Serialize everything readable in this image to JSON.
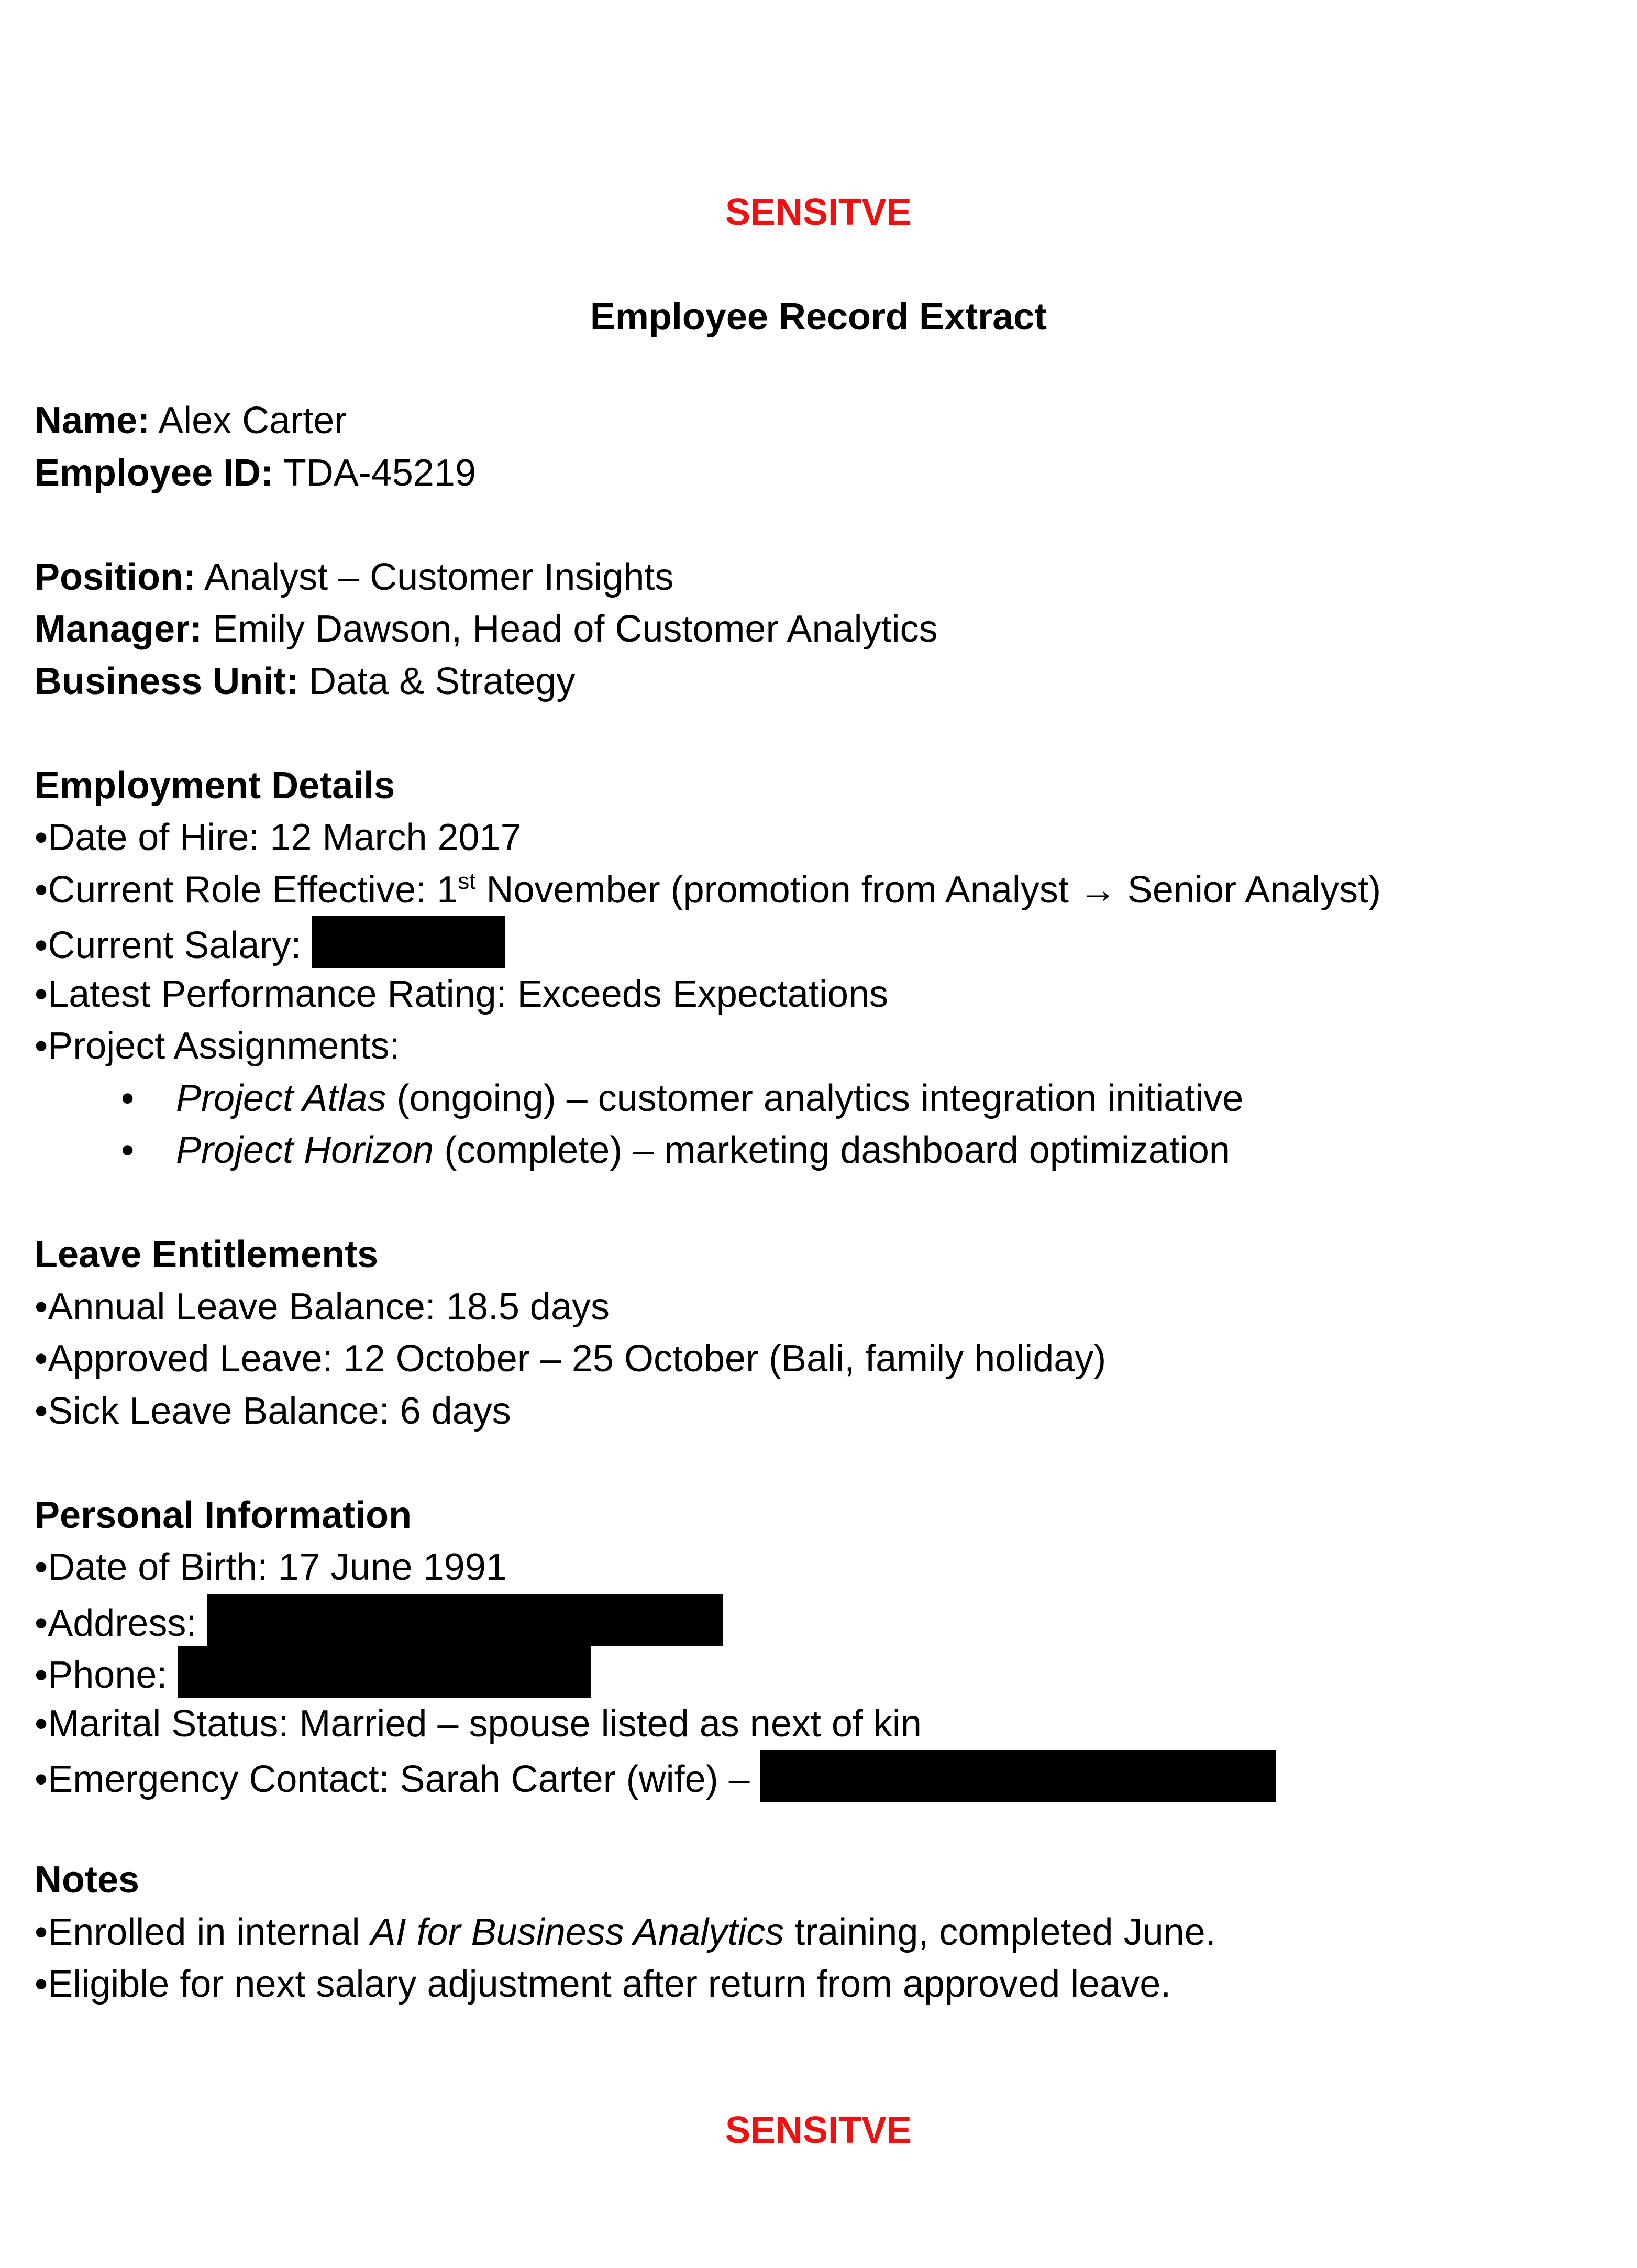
{
  "marking": {
    "top": "SENSITVE",
    "bottom": "SENSITVE",
    "color": "#ee1111"
  },
  "title": "Employee Record Extract",
  "identity": {
    "name_label": "Name:",
    "name_value": " Alex Carter",
    "id_label": "Employee ID:",
    "id_value": " TDA-45219"
  },
  "role": {
    "position_label": "Position:",
    "position_value": " Analyst – Customer Insights",
    "manager_label": "Manager:",
    "manager_value": " Emily Dawson, Head of Customer Analytics",
    "unit_label": "Business Unit:",
    "unit_value": " Data & Strategy"
  },
  "employment": {
    "heading": "Employment Details",
    "hire": "•Date of Hire: 12 March 2017",
    "role_prefix": "•Current Role Effective: 1",
    "role_sup": "st",
    "role_suffix": " November (promotion from Analyst → Senior Analyst)",
    "salary": "•Current Salary: ",
    "rating": "•Latest Performance Rating: Exceeds Expectations",
    "projects_label": "•Project Assignments:",
    "bullet": "•",
    "projects": [
      {
        "name": "Project Atlas",
        "detail": " (ongoing) – customer analytics integration initiative"
      },
      {
        "name": "Project Horizon",
        "detail": " (complete) – marketing dashboard optimization"
      }
    ]
  },
  "leave": {
    "heading": "Leave Entitlements",
    "annual": "•Annual Leave Balance: 18.5 days",
    "approved": "•Approved Leave: 12 October – 25 October (Bali, family holiday)",
    "sick": "•Sick Leave Balance: 6 days"
  },
  "personal": {
    "heading": "Personal Information",
    "dob": "•Date of Birth: 17 June 1991",
    "address": "•Address: ",
    "phone": "•Phone: ",
    "marital": "•Marital Status: Married – spouse listed as next of kin",
    "emergency": "•Emergency Contact: Sarah Carter (wife) – "
  },
  "notes": {
    "heading": "Notes",
    "training_prefix": "•Enrolled in internal ",
    "training_course": "AI for Business Analytics",
    "training_suffix": " training, completed June.",
    "salary_note": "•Eligible for next salary adjustment after return from approved leave."
  }
}
